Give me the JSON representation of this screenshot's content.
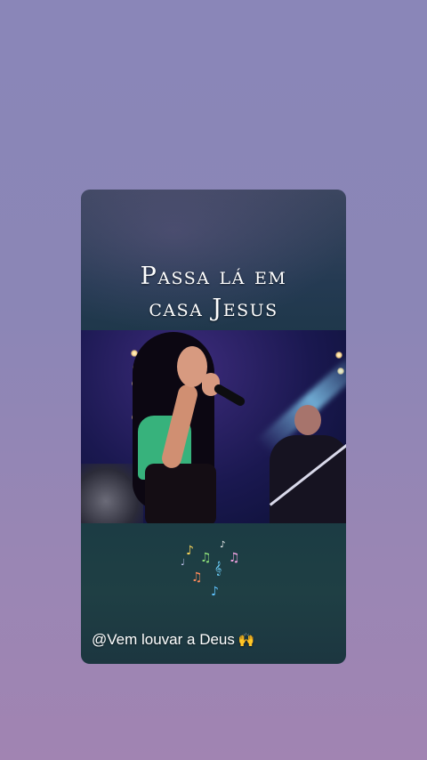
{
  "story": {
    "title_line1": "Passa lá em",
    "title_line2": "casa Jesus",
    "caption": "@Vem louvar a Deus",
    "caption_emoji": "🙌"
  },
  "video": {
    "description_icons": [
      "music-note-icon"
    ]
  },
  "colors": {
    "background_top": "#8a86b8",
    "background_bottom": "#a184b2",
    "card": "#1d3748",
    "shirt": "#37b27c"
  }
}
